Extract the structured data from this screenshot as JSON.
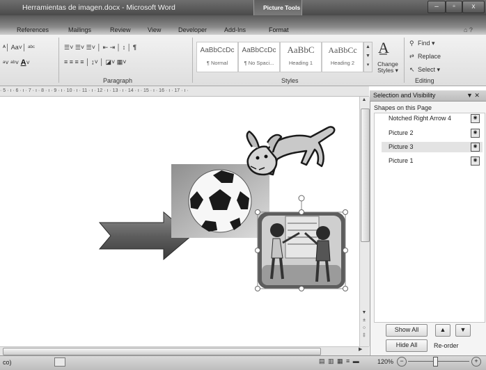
{
  "window": {
    "title": "Herramientas de imagen.docx - Microsoft Word",
    "context_tab_group": "Picture Tools",
    "minimize": "–",
    "maximize": "▫",
    "close": "x"
  },
  "ribbon": {
    "tabs": [
      "References",
      "Mailings",
      "Review",
      "View",
      "Developer",
      "Add-Ins",
      "Format"
    ],
    "help": "⌂ ?",
    "paragraph_label": "Paragraph",
    "styles_label": "Styles",
    "editing_label": "Editing",
    "styles": [
      {
        "preview": "AaBbCcDc",
        "name": "¶ Normal"
      },
      {
        "preview": "AaBbCcDc",
        "name": "¶ No Spaci..."
      },
      {
        "preview": "AaBbC",
        "name": "Heading 1"
      },
      {
        "preview": "AaBbCc",
        "name": "Heading 2"
      }
    ],
    "change_styles": "Change Styles ▾",
    "find": "Find ▾",
    "replace": "Replace",
    "select": "Select ▾"
  },
  "ruler": {
    "text": "· 5 · ı · 6 · ı · 7 · ı · 8 · ı · 9 · ı · 10 · ı · 11 · ı · 12 · ı · 13 · ı · 14 · ı · 15 · ı · 16 · ı · 17 · ı ·"
  },
  "pane": {
    "title": "Selection and Visibility",
    "close": "▼ ✕",
    "subtitle": "Shapes on this Page",
    "items": [
      {
        "label": "Notched Right Arrow 4",
        "selected": false
      },
      {
        "label": "Picture 2",
        "selected": false
      },
      {
        "label": "Picture 3",
        "selected": true
      },
      {
        "label": "Picture 1",
        "selected": false
      }
    ],
    "show_all": "Show All",
    "hide_all": "Hide All",
    "reorder": "Re-order"
  },
  "statusbar": {
    "left_text": "co)",
    "zoom": "120%",
    "zoom_minus": "−",
    "zoom_plus": "+"
  }
}
